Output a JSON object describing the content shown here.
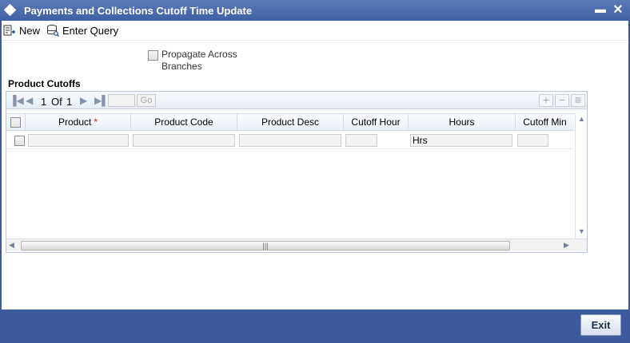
{
  "window": {
    "title": "Payments and Collections Cutoff Time Update",
    "minimize_glyph": "▬",
    "close_glyph": "✕"
  },
  "toolbar": {
    "new_label": "New",
    "enter_query_label": "Enter Query"
  },
  "form": {
    "propagate_label": "Propagate Across Branches",
    "propagate_checked": false
  },
  "product_cutoffs": {
    "section_title": "Product Cutoffs",
    "pager": {
      "current_page": "1",
      "of_label": "Of",
      "total_pages": "1",
      "go_label": "Go"
    },
    "columns": [
      "Product",
      "Product Code",
      "Product Desc",
      "Cutoff Hour",
      "Hours",
      "Cutoff Min"
    ],
    "required_marker": "*",
    "rows": [
      {
        "product": "",
        "product_code": "",
        "product_desc": "",
        "cutoff_hour": "",
        "hours": "Hrs",
        "cutoff_min": ""
      }
    ]
  },
  "footer": {
    "exit_label": "Exit"
  },
  "icons": {
    "title": "diamond-icon",
    "new": "new-record-icon",
    "enter_query": "enter-query-icon",
    "add_row": "plus-icon",
    "delete_row": "minus-icon",
    "single_view": "list-view-icon"
  },
  "colors": {
    "title_bar": "#3f5fa3",
    "footer": "#3d5a9e",
    "required": "#e01818"
  }
}
